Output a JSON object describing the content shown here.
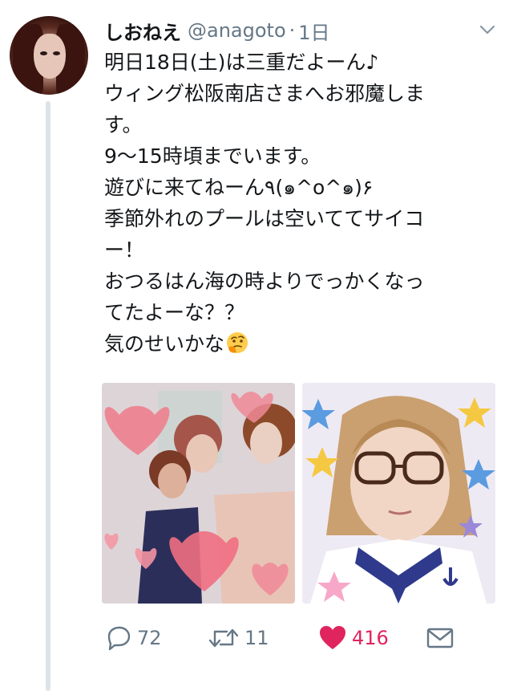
{
  "tweet": {
    "display_name": "しおねえ",
    "handle": "@anagoto",
    "separator": "·",
    "time": "1日",
    "lines": [
      "明日18日(土)は三重だよーん♪",
      "ウィング松阪南店さまへお邪魔しま",
      "す。",
      "9〜15時頃までいます。",
      "遊びに来てねーん٩(๑^o^๑)۶",
      "季節外れのプールは空いててサイコ",
      "ー！",
      "おつるはん海の時よりでっかくなっ",
      "てたよーな？？",
      "気のせいかな"
    ],
    "emoji": "thinking-face-emoji"
  },
  "actions": {
    "reply_count": "72",
    "retweet_count": "11",
    "like_count": "416",
    "like_color": "#e0245e",
    "icon_color": "#657786"
  },
  "colors": {
    "thread_line": "#dde3e8",
    "text": "#14171a",
    "secondary": "#657786"
  }
}
